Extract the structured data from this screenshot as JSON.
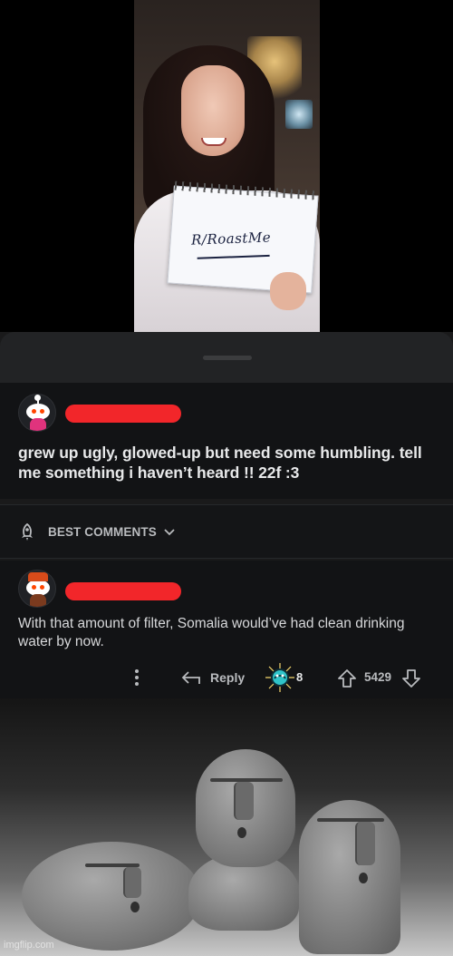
{
  "photo": {
    "sign_text": "R/RoastMe"
  },
  "post": {
    "title": "grew up ugly, glowed-up but need some humbling. tell me something i haven’t heard !! 22f :3"
  },
  "sort": {
    "label": "BEST COMMENTS",
    "icon": "rocket-icon"
  },
  "comment": {
    "body": "With that amount of filter, Somalia would’ve had clean drinking water by now.",
    "actions": {
      "reply_label": "Reply",
      "award_count": "8",
      "vote_count": "5429"
    }
  },
  "meme": {
    "watermark": "imgflip.com"
  },
  "colors": {
    "redaction": "#f2262a",
    "background": "#121315",
    "text": "#e8e9ea",
    "muted_text": "#b9bbbe"
  }
}
